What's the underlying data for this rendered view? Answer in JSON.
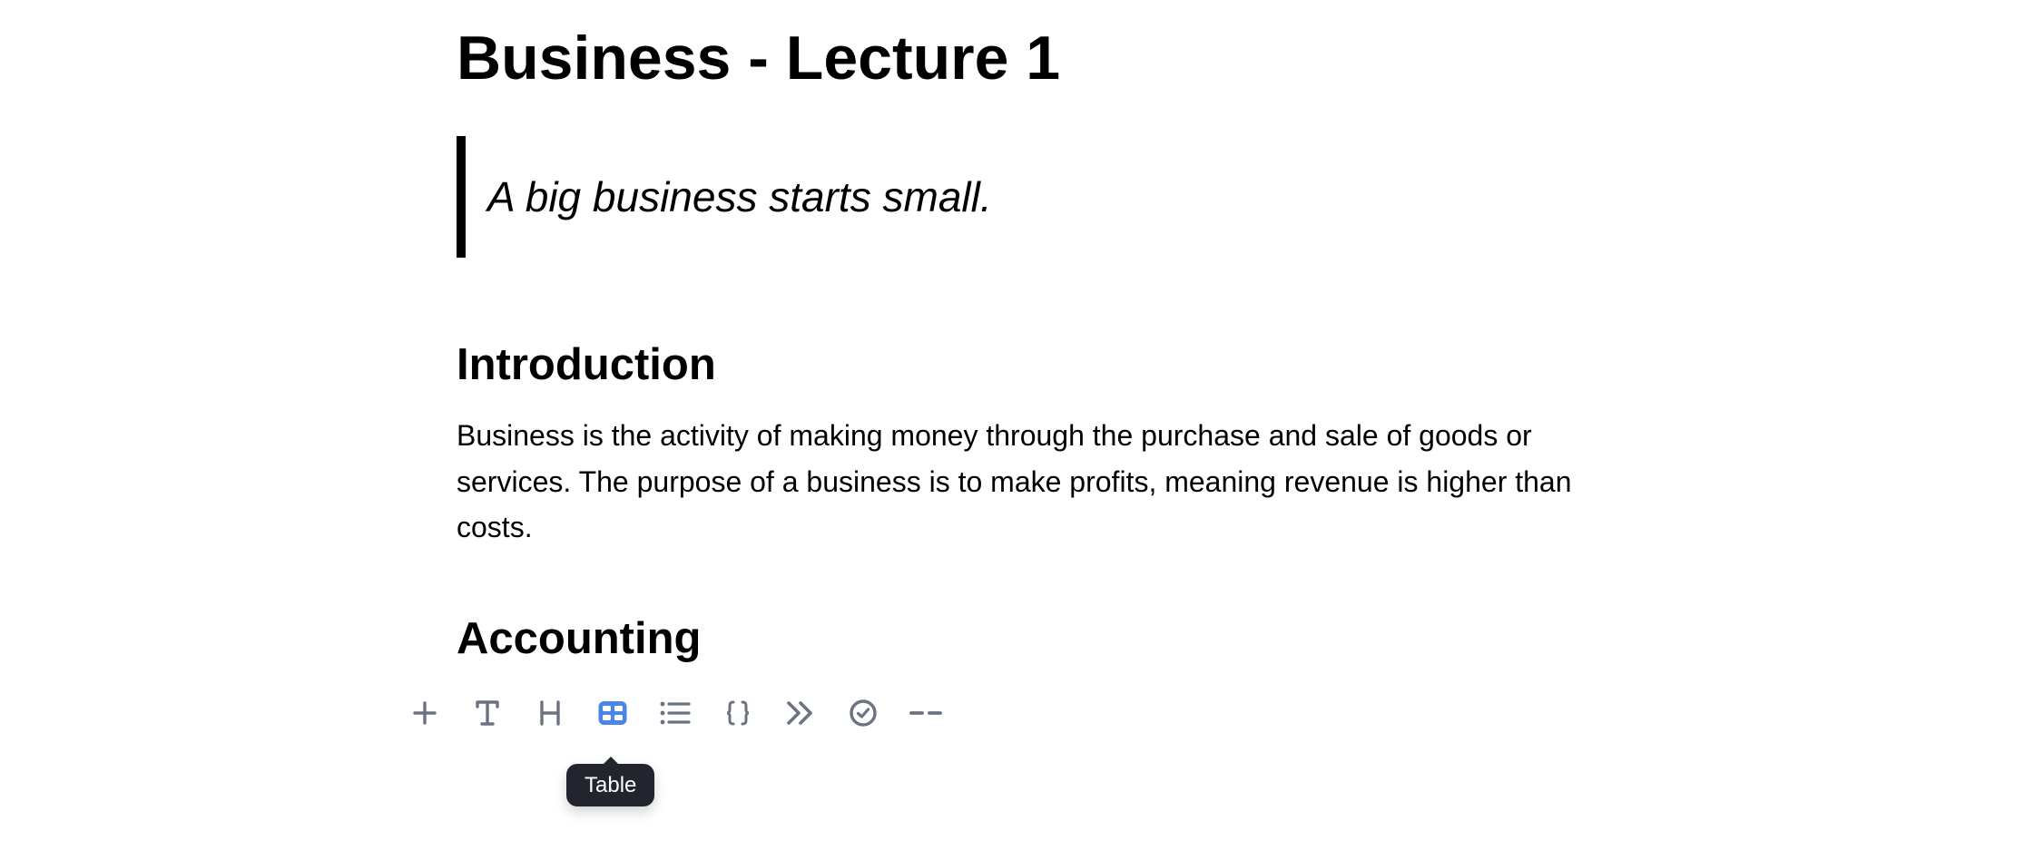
{
  "document": {
    "title": "Business - Lecture 1",
    "quote": "A big business starts small.",
    "sections": [
      {
        "heading": "Introduction",
        "body": "Business is the activity of making money through the purchase and sale of goods or services. The purpose of a business is to make profits, meaning revenue is higher than costs."
      },
      {
        "heading": "Accounting"
      }
    ]
  },
  "toolbar": {
    "items": [
      {
        "icon": "plus-icon"
      },
      {
        "icon": "text-icon"
      },
      {
        "icon": "heading-icon"
      },
      {
        "icon": "table-icon",
        "active": true
      },
      {
        "icon": "list-icon"
      },
      {
        "icon": "code-icon"
      },
      {
        "icon": "quote-icon"
      },
      {
        "icon": "checkbox-icon"
      },
      {
        "icon": "divider-icon"
      }
    ],
    "tooltip": "Table"
  },
  "colors": {
    "icon": "#6b7280",
    "active_icon": "#4a86e8",
    "tooltip_bg": "#22242e"
  }
}
